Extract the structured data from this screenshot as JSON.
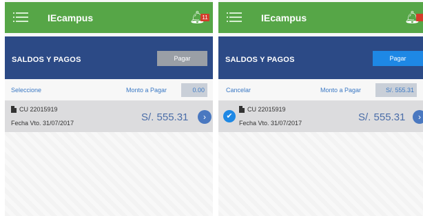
{
  "colors": {
    "topbar": "#56a647",
    "section": "#2c4a86",
    "pay_disabled": "#9a9fa6",
    "pay_active": "#1e88e5",
    "accent": "#4a6da8"
  },
  "left": {
    "app_title": "IEcampus",
    "notification_count": "11",
    "section_title": "SALDOS Y PAGOS",
    "pay_button": "Pagar",
    "select_link": "Seleccione",
    "amount_label": "Monto a Pagar",
    "amount_value": "0.00",
    "item": {
      "code": "CU 22015919",
      "due": "Fecha Vto. 31/07/2017",
      "amount": "S/. 555.31",
      "selected": false
    }
  },
  "right": {
    "app_title": "IEcampus",
    "section_title": "SALDOS Y PAGOS",
    "pay_button": "Pagar",
    "cancel_link": "Cancelar",
    "amount_label": "Monto a Pagar",
    "amount_value": "S/.  555.31",
    "item": {
      "code": "CU 22015919",
      "due": "Fecha Vto. 31/07/2017",
      "amount": "S/. 555.31",
      "selected": true
    }
  },
  "icons": {
    "menu": "menu-icon",
    "bell": "bell-icon",
    "doc": "document-icon",
    "arrow": "chevron-right-icon",
    "check": "check-icon"
  }
}
